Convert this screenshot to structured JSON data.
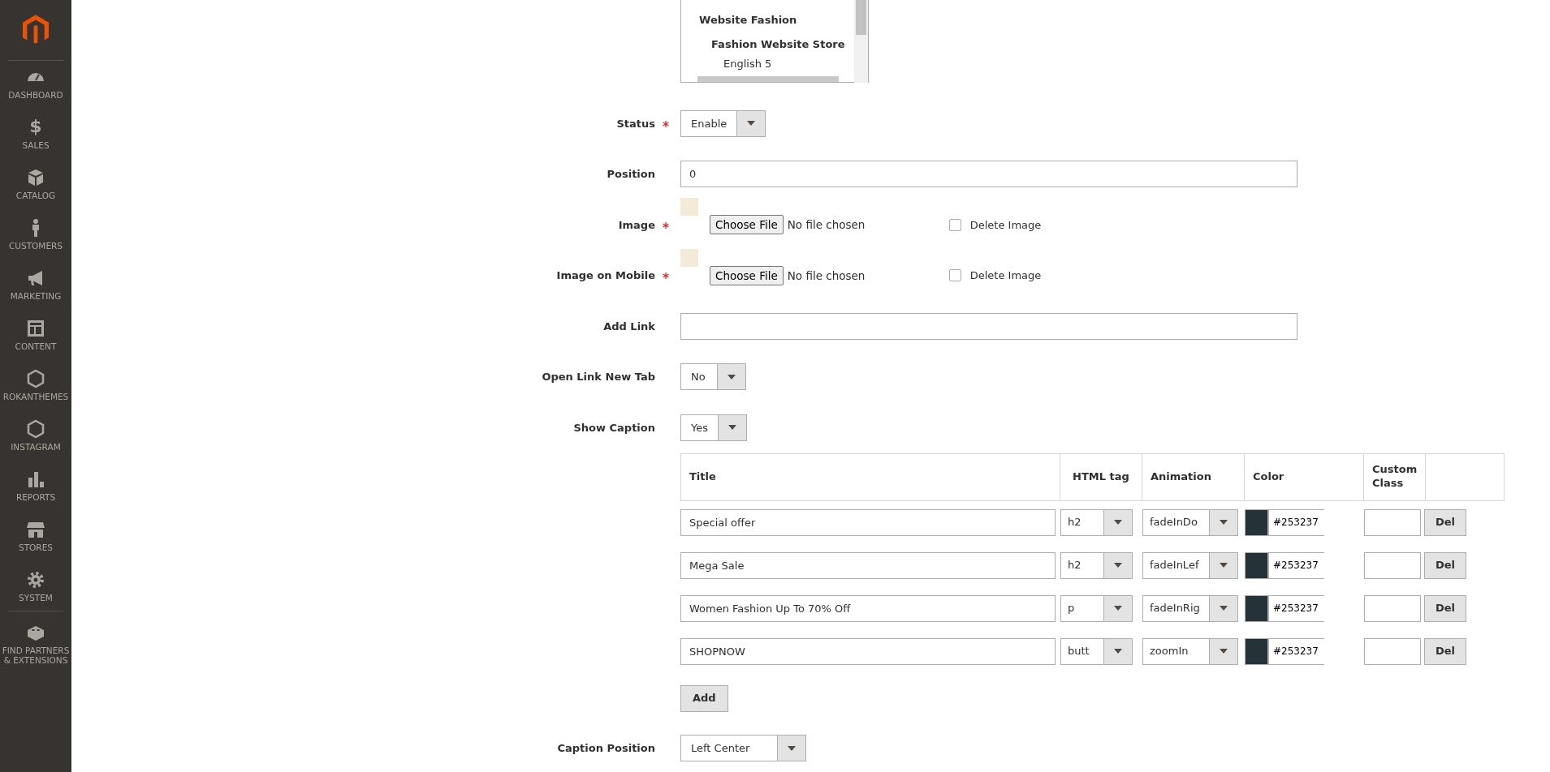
{
  "sidebar": {
    "items": [
      {
        "label": "DASHBOARD"
      },
      {
        "label": "SALES",
        "glyph": "$"
      },
      {
        "label": "CATALOG"
      },
      {
        "label": "CUSTOMERS"
      },
      {
        "label": "MARKETING"
      },
      {
        "label": "CONTENT"
      },
      {
        "label": "ROKANTHEMES"
      },
      {
        "label": "INSTAGRAM"
      },
      {
        "label": "REPORTS"
      },
      {
        "label": "STORES"
      },
      {
        "label": "SYSTEM"
      },
      {
        "label": "FIND PARTNERS & EXTENSIONS"
      }
    ]
  },
  "store_list": {
    "items": [
      {
        "label": "Website Fashion",
        "children": [
          {
            "label": "Fashion Website Store",
            "children": [
              {
                "label": "English 5"
              }
            ]
          }
        ]
      }
    ]
  },
  "fields": [
    {
      "kind": "select",
      "label": "Status",
      "required": true,
      "value": "Enable"
    },
    {
      "kind": "text",
      "label": "Position",
      "required": false,
      "value": "0"
    },
    {
      "kind": "file",
      "label": "Image",
      "required": true,
      "button": "Choose File",
      "file_status": "No file chosen",
      "delete_label": "Delete Image",
      "delete_checked": false
    },
    {
      "kind": "file",
      "label": "Image on Mobile",
      "required": true,
      "button": "Choose File",
      "file_status": "No file chosen",
      "delete_label": "Delete Image",
      "delete_checked": false
    },
    {
      "kind": "text",
      "label": "Add Link",
      "required": false
    },
    {
      "kind": "select",
      "label": "Open Link New Tab",
      "required": false,
      "value": "No"
    },
    {
      "kind": "select",
      "label": "Show Caption",
      "required": false,
      "value": "Yes"
    }
  ],
  "caption_table": {
    "columns": [
      "Title",
      "HTML tag",
      "Animation",
      "Color",
      "Custom Class"
    ],
    "rows": [
      {
        "title": "Special offer",
        "html_tag": "h2",
        "animation": "fadeInDo",
        "color": "#253237",
        "color_text": "#253237",
        "delete": "Del"
      },
      {
        "title": "Mega Sale",
        "html_tag": "h2",
        "animation": "fadeInLef",
        "color": "#253237",
        "color_text": "#253237",
        "delete": "Del"
      },
      {
        "title": "Women Fashion Up To 70% Off",
        "html_tag": "p",
        "animation": "fadeInRig",
        "color": "#253237",
        "color_text": "#253237",
        "delete": "Del"
      },
      {
        "title": "SHOPNOW",
        "html_tag": "butt",
        "animation": "zoomIn",
        "color": "#253237",
        "color_text": "#253237",
        "delete": "Del"
      }
    ],
    "add_button": "Add"
  },
  "caption_position": {
    "label": "Caption Position",
    "value": "Left Center"
  }
}
